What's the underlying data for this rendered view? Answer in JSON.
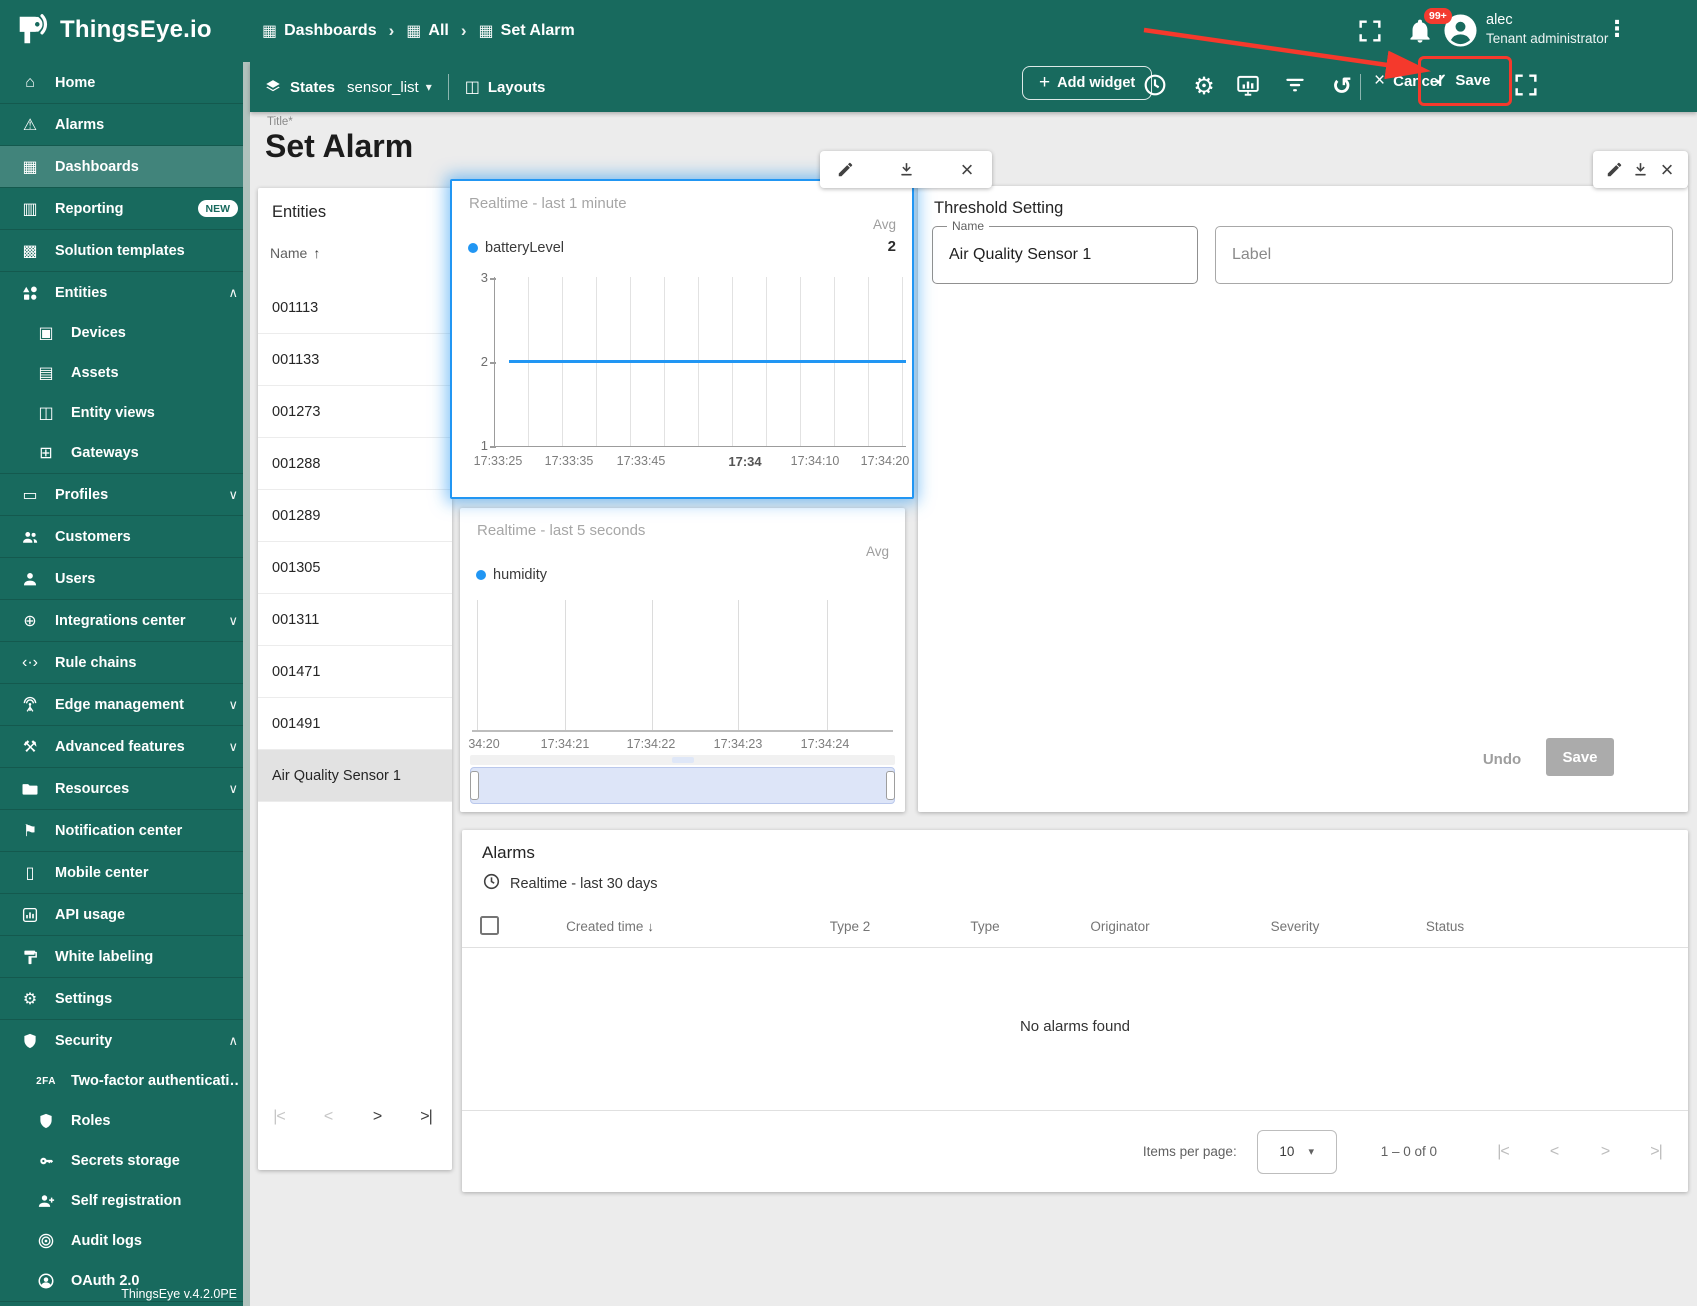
{
  "chart_data": [
    {
      "type": "line",
      "title": "Realtime - last 1 minute",
      "aggregation": "Avg",
      "series": [
        {
          "name": "batteryLevel",
          "color": "#2196f3",
          "avg_value": "2",
          "x": [
            "17:33:25",
            "17:33:35",
            "17:33:45",
            "17:34:00",
            "17:34:10",
            "17:34:20"
          ],
          "y": [
            2,
            2,
            2,
            2,
            2,
            2
          ]
        }
      ],
      "xticks": [
        "17:33:25",
        "17:33:35",
        "17:33:45",
        "17:34",
        "17:34:10",
        "17:34:20"
      ],
      "bold_xtick": "17:34",
      "yticks": [
        "3",
        "2",
        "1"
      ],
      "ylim": [
        1,
        3
      ],
      "grid": "vertical"
    },
    {
      "type": "line",
      "title": "Realtime - last 5 seconds",
      "aggregation": "Avg",
      "series": [
        {
          "name": "humidity",
          "color": "#2196f3",
          "y": []
        }
      ],
      "xticks": [
        "34:20",
        "17:34:21",
        "17:34:22",
        "17:34:23",
        "17:34:24"
      ],
      "empty": true
    }
  ],
  "header": {
    "brand": "ThingsEye.io",
    "breadcrumb": [
      "Dashboards",
      "All",
      "Set Alarm"
    ],
    "notifications_badge": "99+",
    "user": {
      "name": "alec",
      "role": "Tenant administrator"
    }
  },
  "dashboard_toolbar": {
    "states_label": "States",
    "state_value": "sensor_list",
    "layouts_label": "Layouts",
    "add_widget_label": "Add widget",
    "cancel_label": "Cancel",
    "save_label": "Save"
  },
  "sidebar": {
    "version": "ThingsEye v.4.2.0PE",
    "items": [
      {
        "label": "Home",
        "icon": "home"
      },
      {
        "label": "Alarms",
        "icon": "alarms"
      },
      {
        "label": "Dashboards",
        "icon": "dashboards",
        "active": true
      },
      {
        "label": "Reporting",
        "icon": "reporting",
        "badge": "NEW"
      },
      {
        "label": "Solution templates",
        "icon": "solution-templates"
      },
      {
        "label": "Entities",
        "icon": "entities",
        "chevron": "up",
        "children": [
          {
            "label": "Devices",
            "icon": "devices"
          },
          {
            "label": "Assets",
            "icon": "assets"
          },
          {
            "label": "Entity views",
            "icon": "entity-views"
          },
          {
            "label": "Gateways",
            "icon": "gateways"
          }
        ]
      },
      {
        "label": "Profiles",
        "icon": "profiles",
        "chevron": "down"
      },
      {
        "label": "Customers",
        "icon": "customers"
      },
      {
        "label": "Users",
        "icon": "users"
      },
      {
        "label": "Integrations center",
        "icon": "integrations-center",
        "chevron": "down"
      },
      {
        "label": "Rule chains",
        "icon": "rule-chains"
      },
      {
        "label": "Edge management",
        "icon": "edge-management",
        "chevron": "down"
      },
      {
        "label": "Advanced features",
        "icon": "advanced-features",
        "chevron": "down"
      },
      {
        "label": "Resources",
        "icon": "resources",
        "chevron": "down"
      },
      {
        "label": "Notification center",
        "icon": "notification-center"
      },
      {
        "label": "Mobile center",
        "icon": "mobile-center"
      },
      {
        "label": "API usage",
        "icon": "api-usage"
      },
      {
        "label": "White labeling",
        "icon": "white-labeling"
      },
      {
        "label": "Settings",
        "icon": "settings"
      },
      {
        "label": "Security",
        "icon": "security",
        "chevron": "up",
        "children": [
          {
            "label": "Two-factor authenticati…",
            "icon": "two-factor"
          },
          {
            "label": "Roles",
            "icon": "roles"
          },
          {
            "label": "Secrets storage",
            "icon": "secrets-storage"
          },
          {
            "label": "Self registration",
            "icon": "self-registration"
          },
          {
            "label": "Audit logs",
            "icon": "audit-logs"
          },
          {
            "label": "OAuth 2.0",
            "icon": "oauth"
          }
        ]
      }
    ]
  },
  "page": {
    "title_label": "Title*",
    "title": "Set Alarm"
  },
  "entities_widget": {
    "title": "Entities",
    "name_column": "Name",
    "rows": [
      "001113",
      "001133",
      "001273",
      "001288",
      "001289",
      "001305",
      "001311",
      "001471",
      "001491",
      "Air Quality Sensor 1"
    ],
    "selected_row": "Air Quality Sensor 1"
  },
  "threshold_widget": {
    "title": "Threshold Setting",
    "name_label": "Name",
    "name_value": "Air Quality Sensor 1",
    "label_placeholder": "Label",
    "undo_label": "Undo",
    "save_label": "Save"
  },
  "alarms_widget": {
    "title": "Alarms",
    "timewindow": "Realtime - last 30 days",
    "columns": [
      "Created time",
      "Type 2",
      "Type",
      "Originator",
      "Severity",
      "Status"
    ],
    "sorted_column": "Created time",
    "empty_text": "No alarms found",
    "items_per_page_label": "Items per page:",
    "items_per_page": "10",
    "range_text": "1 – 0 of 0"
  },
  "colors": {
    "teal": "#186a5e",
    "accent_red": "#f5392c",
    "chart_blue": "#2196f3"
  }
}
